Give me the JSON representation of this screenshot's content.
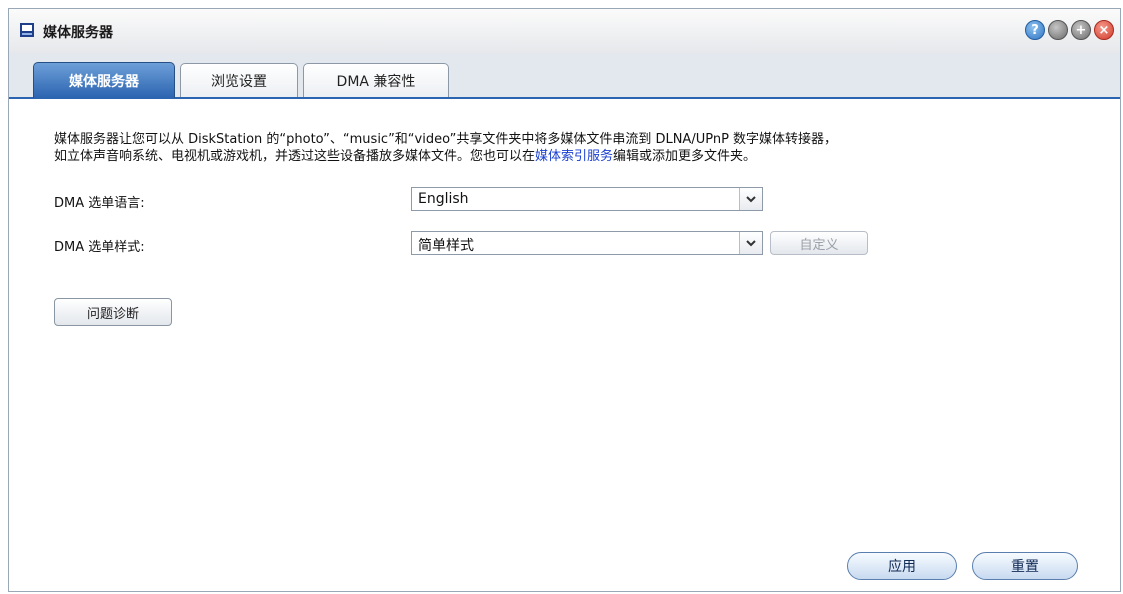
{
  "window": {
    "title": "媒体服务器",
    "controls": {
      "help": "?",
      "minimize": "",
      "maximize": "+",
      "close": "×"
    }
  },
  "tabs": [
    {
      "label": "媒体服务器",
      "active": true
    },
    {
      "label": "浏览设置",
      "active": false
    },
    {
      "label": "DMA 兼容性",
      "active": false
    }
  ],
  "description": {
    "line1": "媒体服务器让您可以从 DiskStation 的“photo”、“music”和“video”共享文件夹中将多媒体文件串流到 DLNA/UPnP 数字媒体转接器，",
    "line2_pre": "如立体声音响系统、电视机或游戏机，并透过这些设备播放多媒体文件。您也可以在",
    "link": "媒体索引服务",
    "line2_post": "编辑或添加更多文件夹。"
  },
  "form": {
    "language_label": "DMA 选单语言:",
    "language_value": "English",
    "style_label": "DMA 选单样式:",
    "style_value": "简单样式",
    "customize_label": "自定义"
  },
  "buttons": {
    "diagnose": "问题诊断",
    "apply": "应用",
    "reset": "重置"
  },
  "colors": {
    "accent": "#2b64b0",
    "link": "#1a3fd1"
  }
}
